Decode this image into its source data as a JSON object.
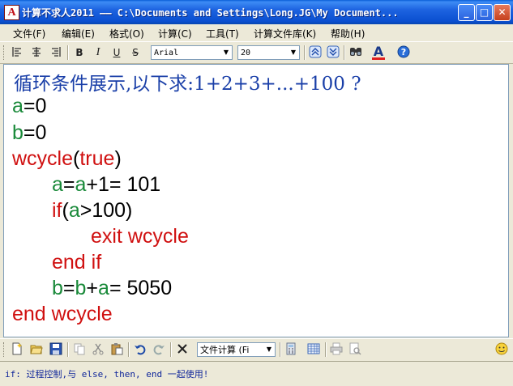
{
  "window": {
    "title": "计算不求人2011 —— C:\\Documents and Settings\\Long.JG\\My Document...",
    "app_icon_letter": "A",
    "controls": {
      "minimize": "_",
      "maximize": "□",
      "close": "✕"
    }
  },
  "menu": [
    "文件(F)",
    "编辑(E)",
    "格式(O)",
    "计算(C)",
    "工具(T)",
    "计算文件库(K)",
    "帮助(H)"
  ],
  "format_toolbar": {
    "font_name": "Arial",
    "font_size": "20",
    "icons": [
      "align-left-icon",
      "align-center-icon",
      "align-right-icon",
      "bold-icon",
      "italic-icon",
      "underline-icon",
      "strikethrough-icon",
      "move-up-icon",
      "move-down-icon",
      "find-icon",
      "font-color-icon",
      "help-icon"
    ],
    "bold_glyph": "B",
    "italic_glyph": "I",
    "underline_glyph": "U",
    "strike_glyph": "S",
    "font_color_glyph": "A"
  },
  "editor": {
    "heading": "循环条件展示,以下求:1+2+3+...+100 ?",
    "lines": [
      {
        "parts": [
          {
            "t": "a",
            "c": "g"
          },
          {
            "t": "=0",
            "c": "k"
          }
        ]
      },
      {
        "parts": [
          {
            "t": "b",
            "c": "g"
          },
          {
            "t": "=0",
            "c": "k"
          }
        ]
      },
      {
        "parts": [
          {
            "t": "wcycle",
            "c": "r"
          },
          {
            "t": "(",
            "c": "k"
          },
          {
            "t": "true",
            "c": "r"
          },
          {
            "t": ")",
            "c": "k"
          }
        ]
      },
      {
        "parts": [
          {
            "t": "a",
            "c": "g"
          },
          {
            "t": "=",
            "c": "k"
          },
          {
            "t": "a",
            "c": "g"
          },
          {
            "t": "+1= 101",
            "c": "k"
          }
        ]
      },
      {
        "parts": [
          {
            "t": "if",
            "c": "r"
          },
          {
            "t": "(",
            "c": "k"
          },
          {
            "t": "a",
            "c": "g"
          },
          {
            "t": ">100)",
            "c": "k"
          }
        ]
      },
      {
        "parts": [
          {
            "t": "exit wcycle",
            "c": "r"
          }
        ]
      },
      {
        "parts": [
          {
            "t": "end if",
            "c": "r"
          }
        ]
      },
      {
        "parts": [
          {
            "t": "b",
            "c": "g"
          },
          {
            "t": "=",
            "c": "k"
          },
          {
            "t": "b",
            "c": "g"
          },
          {
            "t": "+",
            "c": "k"
          },
          {
            "t": "a",
            "c": "g"
          },
          {
            "t": "= 5050",
            "c": "k"
          }
        ]
      },
      {
        "parts": [
          {
            "t": "end wcycle",
            "c": "r"
          }
        ]
      }
    ]
  },
  "bottom_toolbar": {
    "calc_mode": "文件计算 (Fi",
    "icons": [
      "new-icon",
      "open-icon",
      "save-icon",
      "copy-icon",
      "cut-icon",
      "paste-icon",
      "undo-icon",
      "redo-icon",
      "delete-icon",
      "calculator-icon",
      "table-icon",
      "print-icon",
      "print-preview-icon",
      "smiley-icon"
    ]
  },
  "status": "if: 过程控制,与 else, then, end 一起使用!"
}
